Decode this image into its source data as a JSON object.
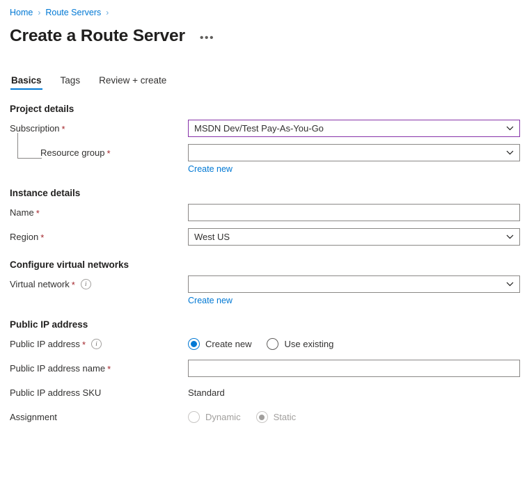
{
  "breadcrumb": {
    "items": [
      {
        "label": "Home"
      },
      {
        "label": "Route Servers"
      }
    ],
    "separator": "›"
  },
  "header": {
    "title": "Create a Route Server",
    "overflow_label": "•••"
  },
  "tabs": [
    {
      "label": "Basics",
      "active": true
    },
    {
      "label": "Tags",
      "active": false
    },
    {
      "label": "Review + create",
      "active": false
    }
  ],
  "sections": {
    "project_details": {
      "title": "Project details",
      "subscription": {
        "label": "Subscription",
        "required_marker": "*",
        "value": "MSDN Dev/Test Pay-As-You-Go"
      },
      "resource_group": {
        "label": "Resource group",
        "required_marker": "*",
        "value": "",
        "create_new_label": "Create new"
      }
    },
    "instance_details": {
      "title": "Instance details",
      "name": {
        "label": "Name",
        "required_marker": "*",
        "value": "",
        "placeholder": ""
      },
      "region": {
        "label": "Region",
        "required_marker": "*",
        "value": "West US"
      }
    },
    "configure_virtual_networks": {
      "title": "Configure virtual networks",
      "virtual_network": {
        "label": "Virtual network",
        "required_marker": "*",
        "info_icon": "info-icon",
        "value": "",
        "create_new_label": "Create new"
      }
    },
    "public_ip_address": {
      "title": "Public IP address",
      "public_ip_choice": {
        "label": "Public IP address",
        "required_marker": "*",
        "info_icon": "info-icon",
        "options": [
          {
            "label": "Create new",
            "selected": true
          },
          {
            "label": "Use existing",
            "selected": false
          }
        ]
      },
      "public_ip_name": {
        "label": "Public IP address name",
        "required_marker": "*",
        "value": "",
        "placeholder": ""
      },
      "public_ip_sku": {
        "label": "Public IP address SKU",
        "value": "Standard"
      },
      "assignment": {
        "label": "Assignment",
        "disabled": true,
        "options": [
          {
            "label": "Dynamic",
            "selected": false
          },
          {
            "label": "Static",
            "selected": true
          }
        ]
      }
    }
  },
  "colors": {
    "accent": "#0078d4",
    "link": "#0078d4",
    "required": "#a4262c",
    "focus_border": "#8632a8",
    "field_border": "#8a8886",
    "text": "#323130",
    "disabled_text": "#a19f9d"
  }
}
